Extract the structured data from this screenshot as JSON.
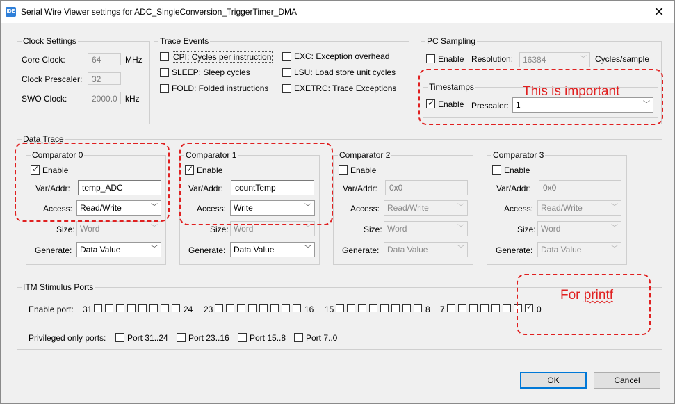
{
  "window": {
    "title": "Serial Wire Viewer settings for ADC_SingleConversion_TriggerTimer_DMA",
    "icon_text": "IDE",
    "close_glyph": "✕"
  },
  "clock": {
    "label": "Clock Settings",
    "core_label": "Core Clock:",
    "core_value": "64",
    "core_unit": "MHz",
    "prescaler_label": "Clock Prescaler:",
    "prescaler_value": "32",
    "swo_label": "SWO Clock:",
    "swo_value": "2000.0",
    "swo_unit": "kHz"
  },
  "trace_events": {
    "label": "Trace Events",
    "items": [
      {
        "label": "CPI: Cycles per instruction",
        "checked": false
      },
      {
        "label": "SLEEP: Sleep cycles",
        "checked": false
      },
      {
        "label": "FOLD: Folded instructions",
        "checked": false
      },
      {
        "label": "EXC: Exception overhead",
        "checked": false
      },
      {
        "label": "LSU: Load store unit cycles",
        "checked": false
      },
      {
        "label": "EXETRC: Trace Exceptions",
        "checked": false
      }
    ]
  },
  "pc_sampling": {
    "label": "PC Sampling",
    "enable_label": "Enable",
    "enabled": false,
    "resolution_label": "Resolution:",
    "resolution_value": "16384",
    "unit": "Cycles/sample",
    "timestamps": {
      "label": "Timestamps",
      "enable_label": "Enable",
      "enabled": true,
      "prescaler_label": "Prescaler:",
      "prescaler_value": "1"
    }
  },
  "data_trace": {
    "label": "Data Trace",
    "comparators": [
      {
        "label": "Comparator 0",
        "enable_label": "Enable",
        "enabled": true,
        "var_label": "Var/Addr:",
        "var": "temp_ADC",
        "access_label": "Access:",
        "access": "Read/Write",
        "size_label": "Size:",
        "size": "Word",
        "generate_label": "Generate:",
        "generate": "Data Value"
      },
      {
        "label": "Comparator 1",
        "enable_label": "Enable",
        "enabled": true,
        "var_label": "Var/Addr:",
        "var": "countTemp",
        "access_label": "Access:",
        "access": "Write",
        "size_label": "Size:",
        "size": "Word",
        "generate_label": "Generate:",
        "generate": "Data Value"
      },
      {
        "label": "Comparator 2",
        "enable_label": "Enable",
        "enabled": false,
        "var_label": "Var/Addr:",
        "var": "0x0",
        "access_label": "Access:",
        "access": "Read/Write",
        "size_label": "Size:",
        "size": "Word",
        "generate_label": "Generate:",
        "generate": "Data Value"
      },
      {
        "label": "Comparator 3",
        "enable_label": "Enable",
        "enabled": false,
        "var_label": "Var/Addr:",
        "var": "0x0",
        "access_label": "Access:",
        "access": "Read/Write",
        "size_label": "Size:",
        "size": "Word",
        "generate_label": "Generate:",
        "generate": "Data Value"
      }
    ]
  },
  "itm": {
    "label": "ITM Stimulus Ports",
    "enable_port_label": "Enable port:",
    "range_labels": [
      "31",
      "24",
      "23",
      "16",
      "15",
      "8",
      "7",
      "0"
    ],
    "enabled_ports": [
      0
    ],
    "privileged_label": "Privileged only ports:",
    "privileged_ports": [
      "Port 31..24",
      "Port 23..16",
      "Port 15..8",
      "Port 7..0"
    ]
  },
  "buttons": {
    "ok": "OK",
    "cancel": "Cancel"
  },
  "annotations": {
    "important": "This is important",
    "printf_prefix": "For ",
    "printf_word": "printf"
  },
  "colors": {
    "annotation": "#e02020",
    "default_button_border": "#0078d7",
    "dialog_bg": "#f0f0f0"
  },
  "icons": {
    "chevron": "chevron-down-icon",
    "close": "close-icon"
  }
}
